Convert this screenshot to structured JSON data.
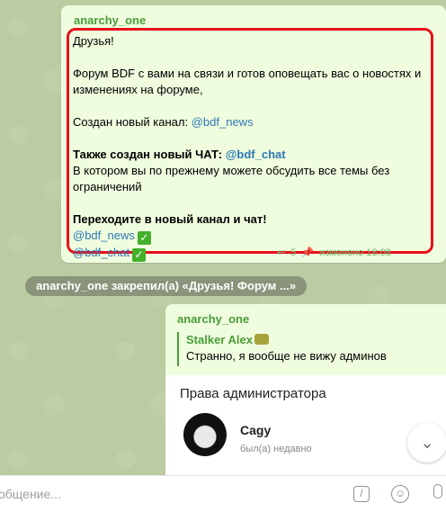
{
  "messages": [
    {
      "sender": "anarchy_one",
      "lines": [
        {
          "text": "Друзья!"
        },
        {
          "text": ""
        },
        {
          "text": "Форум BDF с вами на связи и готов оповещать вас о новостях и"
        },
        {
          "text": "изменениях на форуме,"
        },
        {
          "text": ""
        },
        {
          "text": "Создан новый канал: ",
          "link": "@bdf_news"
        },
        {
          "text": ""
        },
        {
          "text": "Также создан новый ЧАТ: ",
          "bold": true,
          "link": "@bdf_chat"
        },
        {
          "text": "В котором вы по прежнему можете обсудить все темы без"
        },
        {
          "text": "ограничений"
        },
        {
          "text": ""
        },
        {
          "text": "Переходите в новый канал и чат!",
          "bold": true
        },
        {
          "link": "@bdf_news",
          "check": true
        },
        {
          "link": "@bdf_chat",
          "check": true
        }
      ],
      "meta": {
        "reply_count": "5",
        "edited": "изменено 18:08"
      }
    }
  ],
  "service": {
    "text": "anarchy_one закрепил(а) «Друзья!  Форум ...»"
  },
  "message2": {
    "sender": "anarchy_one",
    "reply_author": "Stalker Alex",
    "reply_text": "Странно, я вообще не вижу админов"
  },
  "preview": {
    "title": "Права администратора",
    "user_name": "Сagy",
    "user_status": "был(а) недавно"
  },
  "input": {
    "placeholder": "общение..."
  },
  "icons": {
    "reply": "reply-icon",
    "pin": "pin-icon",
    "check": "check-icon",
    "commands": "slash-command-icon",
    "emoji": "emoji-icon",
    "mic": "microphone-icon",
    "scroll": "chevron-down-icon"
  },
  "colors": {
    "accent": "#4a9b3a",
    "link": "#2e78b5",
    "highlight": "#e6111a"
  }
}
